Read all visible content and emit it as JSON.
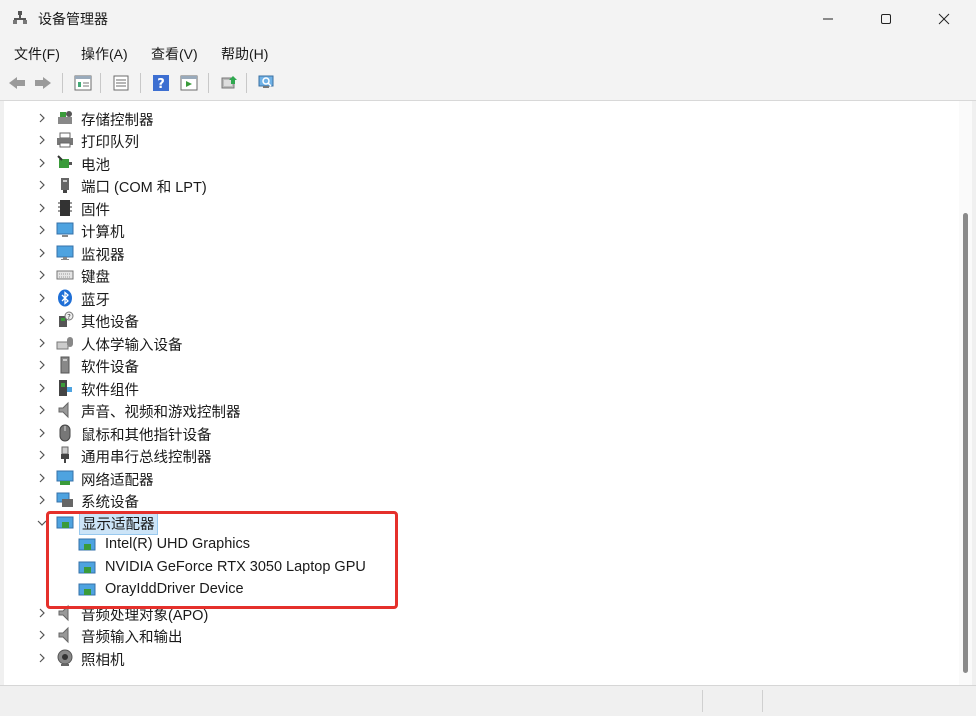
{
  "window": {
    "title": "设备管理器"
  },
  "menu": [
    "文件(F)",
    "操作(A)",
    "查看(V)",
    "帮助(H)"
  ],
  "toolbar": [
    "back-icon",
    "forward-icon",
    "properties-icon",
    "update-list-icon",
    "help-icon",
    "show-hidden-icon",
    "update-driver-icon",
    "scan-hardware-icon"
  ],
  "tree": {
    "items": [
      {
        "label": "存储控制器",
        "icon": "storage-controller-icon",
        "expanded": false
      },
      {
        "label": "打印队列",
        "icon": "printer-icon",
        "expanded": false
      },
      {
        "label": "电池",
        "icon": "battery-icon",
        "expanded": false
      },
      {
        "label": "端口 (COM 和 LPT)",
        "icon": "port-icon",
        "expanded": false
      },
      {
        "label": "固件",
        "icon": "firmware-icon",
        "expanded": false
      },
      {
        "label": "计算机",
        "icon": "computer-icon",
        "expanded": false
      },
      {
        "label": "监视器",
        "icon": "monitor-icon",
        "expanded": false
      },
      {
        "label": "键盘",
        "icon": "keyboard-icon",
        "expanded": false
      },
      {
        "label": "蓝牙",
        "icon": "bluetooth-icon",
        "expanded": false
      },
      {
        "label": "其他设备",
        "icon": "unknown-device-icon",
        "expanded": false
      },
      {
        "label": "人体学输入设备",
        "icon": "hid-icon",
        "expanded": false
      },
      {
        "label": "软件设备",
        "icon": "software-device-icon",
        "expanded": false
      },
      {
        "label": "软件组件",
        "icon": "software-component-icon",
        "expanded": false
      },
      {
        "label": "声音、视频和游戏控制器",
        "icon": "speaker-icon",
        "expanded": false
      },
      {
        "label": "鼠标和其他指针设备",
        "icon": "mouse-icon",
        "expanded": false
      },
      {
        "label": "通用串行总线控制器",
        "icon": "usb-icon",
        "expanded": false
      },
      {
        "label": "网络适配器",
        "icon": "network-adapter-icon",
        "expanded": false
      },
      {
        "label": "系统设备",
        "icon": "system-device-icon",
        "expanded": false
      },
      {
        "label": "显示适配器",
        "icon": "display-adapter-icon",
        "expanded": true,
        "selected": true,
        "children": [
          {
            "label": "Intel(R) UHD Graphics",
            "icon": "display-adapter-icon"
          },
          {
            "label": "NVIDIA GeForce RTX 3050 Laptop GPU",
            "icon": "display-adapter-icon"
          },
          {
            "label": "OrayIddDriver Device",
            "icon": "display-adapter-icon"
          }
        ]
      },
      {
        "label": "音频处理对象(APO)",
        "icon": "speaker-icon",
        "expanded": false
      },
      {
        "label": "音频输入和输出",
        "icon": "speaker-icon",
        "expanded": false
      },
      {
        "label": "照相机",
        "icon": "camera-icon",
        "expanded": false
      }
    ]
  },
  "colors": {
    "highlight_box": "#e5302b",
    "selection": "#cce4f7"
  }
}
